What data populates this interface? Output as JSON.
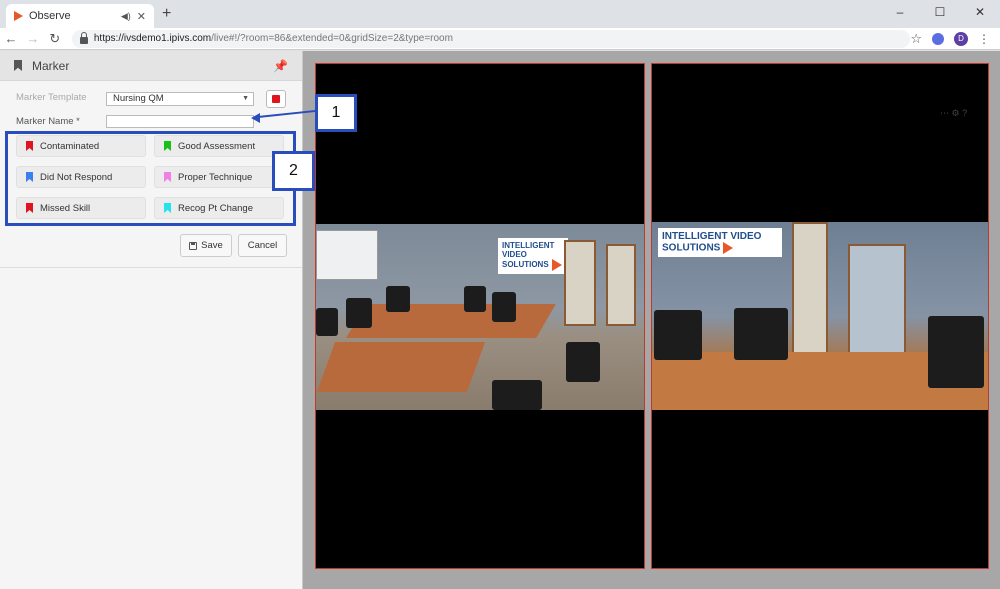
{
  "browser": {
    "tab_title": "Observe",
    "new_tab": "+",
    "url_host": "https://ivsdemo1.ipivs.com",
    "url_path": "/live#!/?room=86&extended=0&gridSize=2&type=room",
    "profile_initial": "D",
    "window_controls": [
      "–",
      "☐",
      "✕"
    ]
  },
  "panel": {
    "title": "Marker",
    "template_label": "Marker Template",
    "template_value": "Nursing QM",
    "name_label": "Marker Name *",
    "name_value": "",
    "record_color": "#e0141e",
    "markers": [
      {
        "label": "Contaminated",
        "color": "#e0141e"
      },
      {
        "label": "Good Assessment",
        "color": "#16c216"
      },
      {
        "label": "Did Not Respond",
        "color": "#3a7ff0"
      },
      {
        "label": "Proper Technique",
        "color": "#f07fe6"
      },
      {
        "label": "Missed Skill",
        "color": "#e0141e"
      },
      {
        "label": "Recog Pt Change",
        "color": "#22e3ef"
      }
    ],
    "save_label": "Save",
    "cancel_label": "Cancel"
  },
  "video": {
    "sign1": "INTELLIGENT VIDEO SOLUTIONS",
    "sign2": "INTELLIGENT VIDEO SOLUTIONS"
  },
  "annotations": {
    "callout1": "1",
    "callout2": "2"
  },
  "colors": {
    "accent": "#2a4dbd",
    "tile_border": "#c0392b"
  }
}
